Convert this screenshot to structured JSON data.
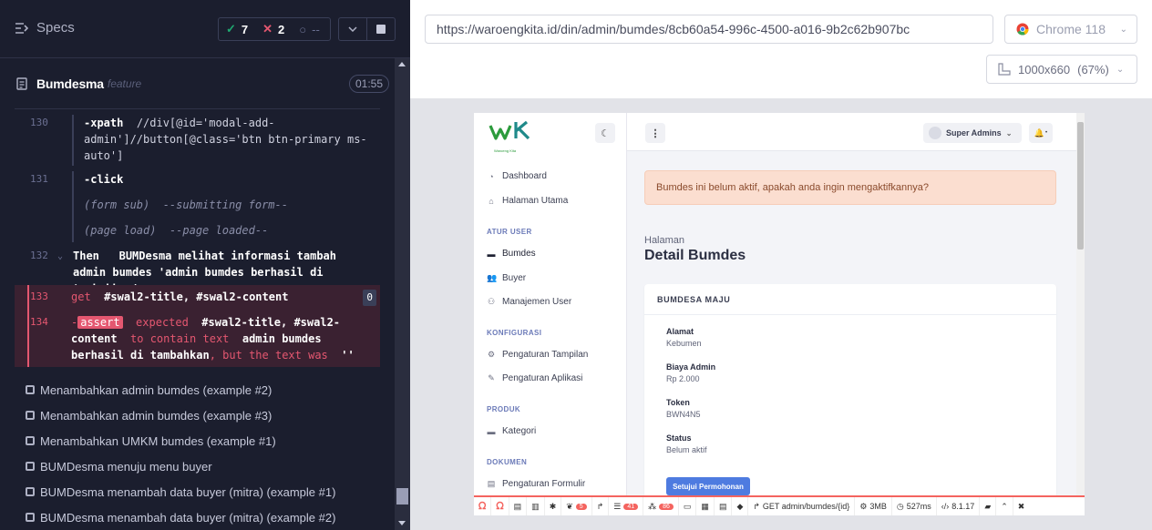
{
  "reporter": {
    "specs_label": "Specs",
    "stats": {
      "passed": "7",
      "failed": "2",
      "pending": "--"
    },
    "suite": {
      "title": "Bumdesma",
      "type": "feature",
      "duration": "01:55"
    },
    "commands": [
      {
        "num": "130",
        "name": "-xpath",
        "message": "//div[@id='modal-add-admin']//button[@class='btn btn-primary ms-auto']"
      },
      {
        "num": "131",
        "name": "-click",
        "message": ""
      },
      {
        "num": "",
        "name": "(form sub)",
        "message": "--submitting form--"
      },
      {
        "num": "",
        "name": "(page load)",
        "message": "--page loaded--"
      }
    ],
    "step": {
      "num": "132",
      "keyword": "Then",
      "text": "BUMDesma melihat informasi tambah admin bumdes 'admin bumdes berhasil di tambahkan'"
    },
    "error_get": {
      "num": "133",
      "name": "get",
      "message": "#swal2-title, #swal2-content",
      "count": "0"
    },
    "error_assert": {
      "num": "134",
      "badge": "assert",
      "expected": "expected",
      "selector": "#swal2-title, #swal2-content",
      "to_contain": "to contain text",
      "text": "admin bumdes berhasil di tambahkan",
      "but": ", but the text was",
      "was": "''"
    },
    "tests": [
      "Menambahkan admin bumdes (example #2)",
      "Menambahkan admin bumdes (example #3)",
      "Menambahkan UMKM bumdes (example #1)",
      "BUMDesma menuju menu buyer",
      "BUMDesma menambah data buyer (mitra) (example #1)",
      "BUMDesma menambah data buyer (mitra) (example #2)"
    ]
  },
  "browser": {
    "url": "https://waroengkita.id/din/admin/bumdes/8cb60a54-996c-4500-a016-9b2c62b907bc",
    "browser_name": "Chrome 118",
    "viewport": "1000x660",
    "zoom": "(67%)"
  },
  "app": {
    "logo_text": "Waroeng Kita",
    "sidebar": {
      "items_top": [
        {
          "label": "Dashboard",
          "icon": "dashboard-icon"
        },
        {
          "label": "Halaman Utama",
          "icon": "home-icon"
        }
      ],
      "section_user": "ATUR USER",
      "items_user": [
        {
          "label": "Bumdes",
          "icon": "store-icon"
        },
        {
          "label": "Buyer",
          "icon": "users-icon"
        },
        {
          "label": "Manajemen User",
          "icon": "user-icon"
        }
      ],
      "section_config": "KONFIGURASI",
      "items_config": [
        {
          "label": "Pengaturan Tampilan",
          "icon": "gear-icon"
        },
        {
          "label": "Pengaturan Aplikasi",
          "icon": "wrench-icon"
        }
      ],
      "section_product": "PRODUK",
      "items_product": [
        {
          "label": "Kategori",
          "icon": "store-icon"
        }
      ],
      "section_docs": "DOKUMEN",
      "items_docs": [
        {
          "label": "Pengaturan Formulir",
          "icon": "file-icon"
        }
      ]
    },
    "topbar": {
      "user": "Super Admins"
    },
    "alert": "Bumdes ini belum aktif, apakah anda ingin mengaktifkannya?",
    "page_pretitle": "Halaman",
    "page_title": "Detail Bumdes",
    "card": {
      "title": "BUMDESA MAJU",
      "fields": [
        {
          "label": "Alamat",
          "value": "Kebumen"
        },
        {
          "label": "Biaya Admin",
          "value": "Rp 2.000"
        },
        {
          "label": "Token",
          "value": "BWN4N5"
        },
        {
          "label": "Status",
          "value": "Belum aktif"
        }
      ],
      "approve": "Setujui Permohonan"
    },
    "debugbar": {
      "messages": "5",
      "queries": "41",
      "models": "86",
      "route": "GET admin/bumdes/{id}",
      "memory": "3MB",
      "time": "527ms",
      "php": "8.1.17"
    }
  },
  "colors": {
    "reporter_bg": "#1b1e2e",
    "pass": "#1fa971",
    "fail": "#e45770",
    "accent": "#4e7be0",
    "alert_bg": "#fbded0"
  }
}
